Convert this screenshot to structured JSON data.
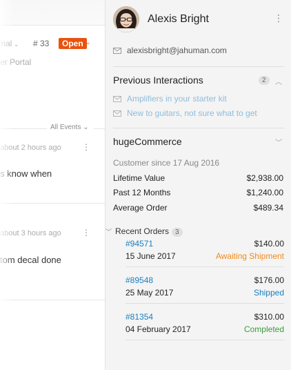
{
  "left": {
    "status_select": "mal",
    "ticket_number": "# 33",
    "status_badge": "Open",
    "portal_text": "er Portal",
    "all_events_label": "All Events",
    "events": [
      {
        "time_prefix": "about",
        "time_text": "about 2 hours ago",
        "body": "s know when"
      },
      {
        "time_prefix": "about",
        "time_text": "about 3 hours ago",
        "body": "tom decal done"
      }
    ]
  },
  "customer": {
    "name": "Alexis Bright",
    "email": "alexisbright@jahuman.com"
  },
  "previous_interactions": {
    "title": "Previous Interactions",
    "count": "2",
    "items": [
      "Amplifiers in your starter kit",
      "New to guitars, not sure what to get"
    ]
  },
  "commerce": {
    "title": "hugeCommerce",
    "customer_since": "Customer since 17 Aug 2016",
    "stats": [
      {
        "label": "Lifetime Value",
        "value": "$2,938.00"
      },
      {
        "label": "Past 12 Months",
        "value": "$1,240.00"
      },
      {
        "label": "Average Order",
        "value": "$489.34"
      }
    ],
    "recent_orders_label": "Recent Orders",
    "recent_orders_count": "3",
    "orders": [
      {
        "id": "#94571",
        "date": "15 June 2017",
        "amount": "$140.00",
        "status": "Awaiting Shipment",
        "status_color": "#f08a1c"
      },
      {
        "id": "#89548",
        "date": "25 May 2017",
        "amount": "$176.00",
        "status": "Shipped",
        "status_color": "#1a7fbf"
      },
      {
        "id": "#81354",
        "date": "04 February 2017",
        "amount": "$310.00",
        "status": "Completed",
        "status_color": "#3c9a3c"
      }
    ]
  },
  "colors": {
    "accent_open": "#e8520f",
    "link_blue": "#1a7fbf"
  }
}
